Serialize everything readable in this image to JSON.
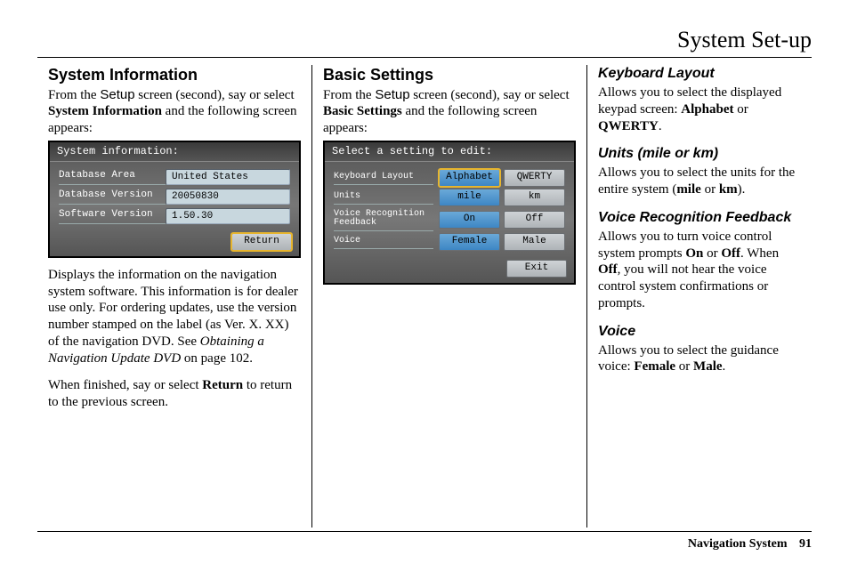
{
  "chapter_title": "System Set-up",
  "footer": {
    "label": "Navigation System",
    "page_num": "91"
  },
  "col1": {
    "heading": "System Information",
    "intro_pre": "From the ",
    "intro_screen": "Setup",
    "intro_mid": " screen (second), say or select ",
    "intro_bold": "System Information",
    "intro_post": " and the following screen appears:",
    "shot": {
      "title": "System information:",
      "rows": [
        {
          "label": "Database Area",
          "value": "United States"
        },
        {
          "label": "Database Version",
          "value": "20050830"
        },
        {
          "label": "Software Version",
          "value": "1.50.30"
        }
      ],
      "return_btn": "Return"
    },
    "para2_a": "Displays the information on the navigation system software. This information is for dealer use only. For ordering updates, use the version number stamped on the label (as Ver. X. XX) of the navigation DVD. See ",
    "para2_link": "Obtaining a Navigation Update DVD",
    "para2_b": " on page 102.",
    "para3_a": "When finished, say or select ",
    "para3_bold": "Return",
    "para3_b": " to return to the previous screen."
  },
  "col2": {
    "heading": "Basic Settings",
    "intro_pre": "From the ",
    "intro_screen": "Setup",
    "intro_mid": " screen (second), say or select ",
    "intro_bold": "Basic Settings",
    "intro_post": " and the following screen appears:",
    "shot": {
      "title": "Select a setting to edit:",
      "rows": [
        {
          "label": "Keyboard Layout",
          "opt1": "Alphabet",
          "opt2": "QWERTY",
          "sel": 1,
          "hi": true
        },
        {
          "label": "Units",
          "opt1": "mile",
          "opt2": "km",
          "sel": 1
        },
        {
          "label": "Voice Recognition Feedback",
          "opt1": "On",
          "opt2": "Off",
          "sel": 1
        },
        {
          "label": "Voice",
          "opt1": "Female",
          "opt2": "Male",
          "sel": 1
        }
      ],
      "exit_btn": "Exit"
    }
  },
  "col3": {
    "s1_head": "Keyboard Layout",
    "s1_a": "Allows you to select the displayed keypad screen: ",
    "s1_b1": "Alphabet",
    "s1_mid": " or ",
    "s1_b2": "QWERTY",
    "s1_end": ".",
    "s2_head": "Units (mile or km)",
    "s2_a": "Allows you to select the units for the entire system (",
    "s2_b1": "mile",
    "s2_mid": " or ",
    "s2_b2": "km",
    "s2_end": ").",
    "s3_head": "Voice Recognition Feedback",
    "s3_a": "Allows you to turn voice control system prompts ",
    "s3_b1": "On",
    "s3_mid": " or ",
    "s3_b2": "Off",
    "s3_c": ". When ",
    "s3_b3": "Off",
    "s3_d": ", you will not hear the voice control system confirmations or prompts.",
    "s4_head": "Voice",
    "s4_a": "Allows you to select the guidance voice: ",
    "s4_b1": "Female",
    "s4_mid": " or ",
    "s4_b2": "Male",
    "s4_end": "."
  }
}
